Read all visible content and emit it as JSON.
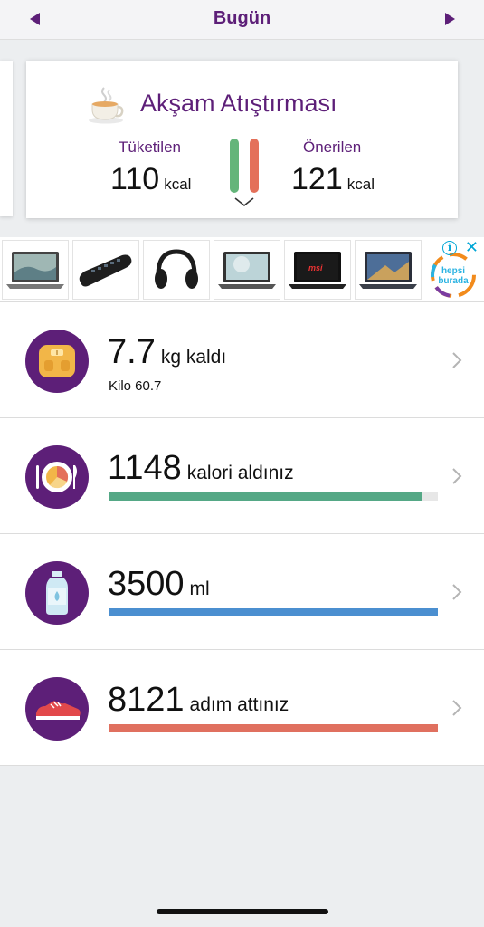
{
  "header": {
    "title": "Bugün",
    "prev_icon": "triangle-left-icon",
    "next_icon": "triangle-right-icon",
    "accent_color": "#5d1f78"
  },
  "meal_card": {
    "title": "Akşam Atıştırması",
    "icon": "tea-cup-icon",
    "consumed": {
      "label": "Tüketilen",
      "value": "110",
      "unit": "kcal"
    },
    "suggested": {
      "label": "Önerilen",
      "value": "121",
      "unit": "kcal"
    },
    "consumed_color": "#64b57a",
    "suggested_color": "#e4705a",
    "expand_icon": "chevron-down-icon"
  },
  "ad": {
    "info_label": "i",
    "close_label": "✕",
    "brand_line1": "hepsi",
    "brand_line2": "burada",
    "items": [
      "laptop",
      "usb-hub",
      "headphones",
      "laptop",
      "laptop-msi",
      "laptop"
    ],
    "msi_label": "msi"
  },
  "rows": [
    {
      "icon": "scale-icon",
      "value": "7.7",
      "unit": "kg kaldı",
      "subtitle": "Kilo 60.7"
    },
    {
      "icon": "plate-icon",
      "value": "1148",
      "unit": "kalori aldınız",
      "progress": 0.95,
      "color": "#55a886"
    },
    {
      "icon": "water-bottle-icon",
      "value": "3500",
      "unit": "ml",
      "progress": 1.0,
      "color": "#4b8fd0"
    },
    {
      "icon": "sneaker-icon",
      "value": "8121",
      "unit": "adım attınız",
      "progress": 1.0,
      "color": "#e0705f"
    }
  ]
}
